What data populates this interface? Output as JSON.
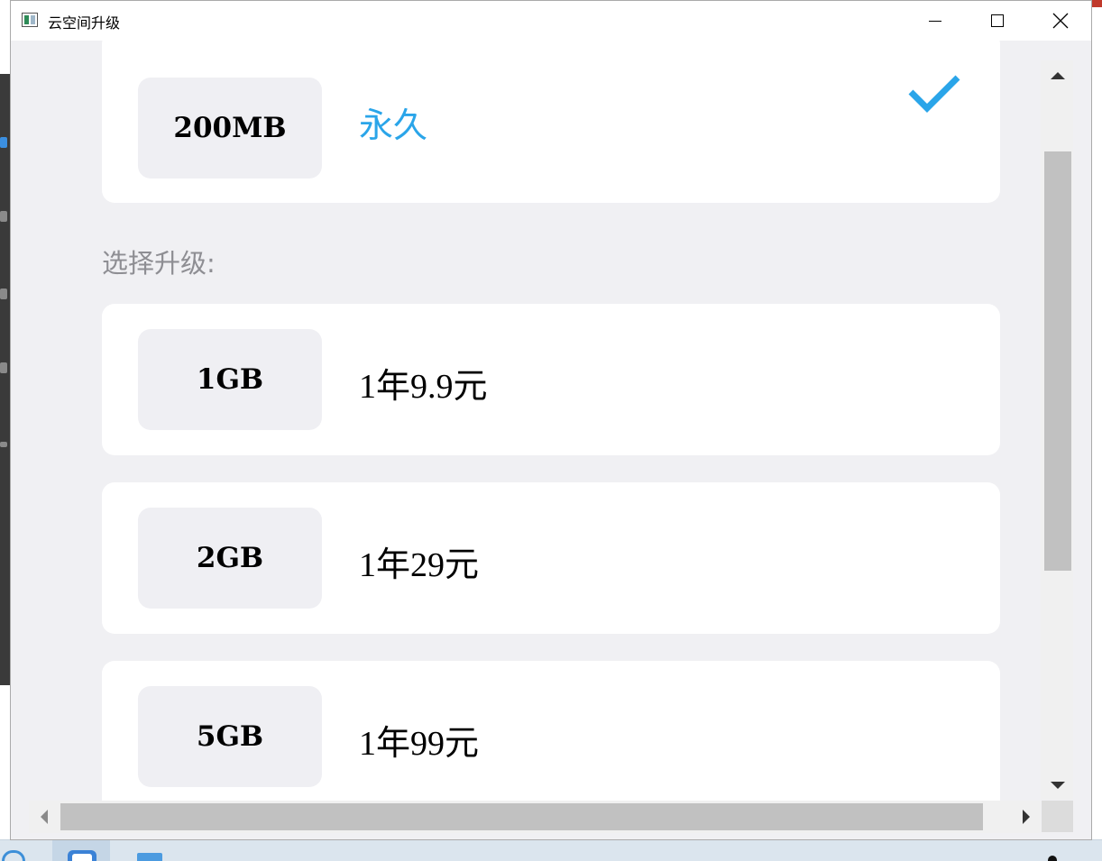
{
  "window": {
    "title": "云空间升级",
    "controls": {
      "minimize": "minimize-icon",
      "maximize": "maximize-icon",
      "close": "close-icon"
    }
  },
  "current_plan": {
    "size": "200MB",
    "duration": "永久",
    "selected_icon": "check-icon",
    "accent_color": "#2aa5e9"
  },
  "section_label": "选择升级:",
  "upgrade_options": [
    {
      "size": "1GB",
      "price": "1年9.9元"
    },
    {
      "size": "2GB",
      "price": "1年29元"
    },
    {
      "size": "5GB",
      "price": "1年99元"
    }
  ],
  "scrollbars": {
    "vertical": {
      "up": "arrow-up-icon",
      "down": "arrow-down-icon"
    },
    "horizontal": {
      "left": "arrow-left-icon",
      "right": "arrow-right-icon"
    }
  }
}
